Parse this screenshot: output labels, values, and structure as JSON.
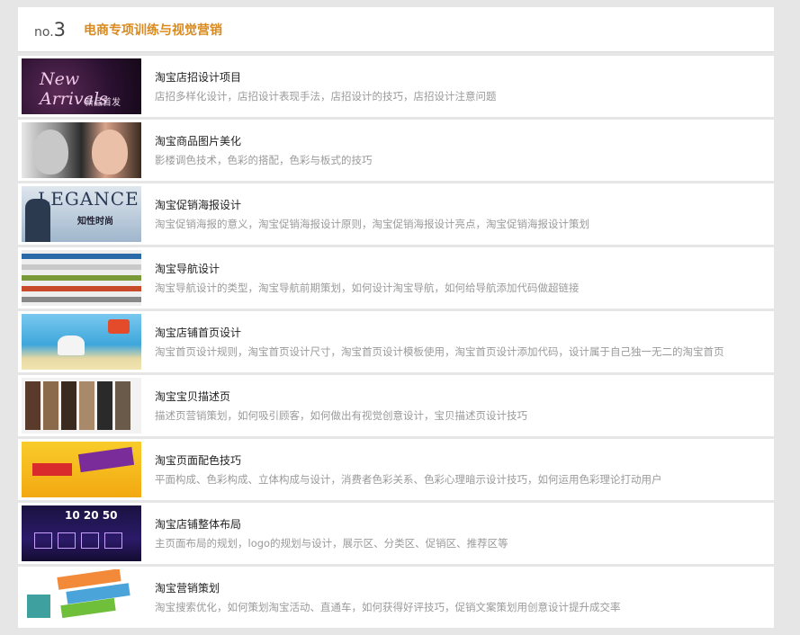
{
  "header": {
    "prefix": "no.",
    "number": "3",
    "title": "电商专项训练与视觉营销"
  },
  "items": [
    {
      "title": "淘宝店招设计项目",
      "desc": "店招多样化设计，店招设计表现手法，店招设计的技巧，店招设计注意问题"
    },
    {
      "title": "淘宝商品图片美化",
      "desc": "影楼调色技术，色彩的搭配，色彩与板式的技巧"
    },
    {
      "title": "淘宝促销海报设计",
      "desc": "淘宝促销海报的意义，淘宝促销海报设计原则，淘宝促销海报设计亮点，淘宝促销海报设计策划"
    },
    {
      "title": "淘宝导航设计",
      "desc": "淘宝导航设计的类型，淘宝导航前期策划，如何设计淘宝导航，如何给导航添加代码做超链接"
    },
    {
      "title": "淘宝店铺首页设计",
      "desc": "淘宝首页设计规则，淘宝首页设计尺寸，淘宝首页设计模板使用，淘宝首页设计添加代码，设计属于自己独一无二的淘宝首页"
    },
    {
      "title": "淘宝宝贝描述页",
      "desc": "描述页营销策划，如何吸引顾客，如何做出有视觉创意设计，宝贝描述页设计技巧"
    },
    {
      "title": "淘宝页面配色技巧",
      "desc": "平面构成、色彩构成、立体构成与设计，消费者色彩关系、色彩心理暗示设计技巧，如何运用色彩理论打动用户"
    },
    {
      "title": "淘宝店铺整体布局",
      "desc": "主页面布局的规划，logo的规划与设计，展示区、分类区、促销区、推荐区等"
    },
    {
      "title": "淘宝营销策划",
      "desc": "淘宝搜索优化，如何策划淘宝活动、直通车，如何获得好评技巧，促销文案策划用创意设计提升成交率"
    }
  ],
  "thumbs": {
    "t1_big": "New Arrivals",
    "t1_small": "新品首发",
    "t3_word": "LEGANCE",
    "t3_sub": "知性时尚",
    "t8_clock": "10 20 50"
  }
}
